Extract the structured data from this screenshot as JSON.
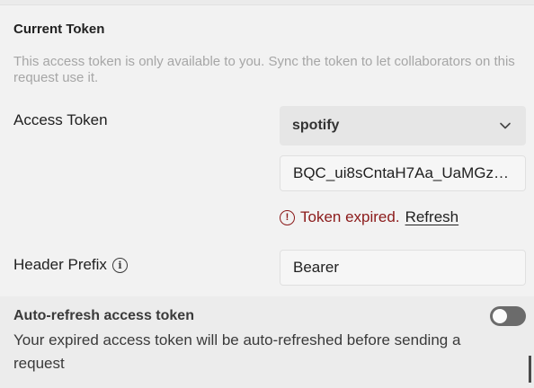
{
  "section": {
    "title": "Current Token",
    "description": "This access token is only available to you. Sync the token to let collaborators on this request use it."
  },
  "access_token": {
    "label": "Access Token",
    "selected_token": "spotify",
    "value": "BQC_ui8sCntaH7Aa_UaMGzF...",
    "status_text": "Token expired.",
    "refresh_label": "Refresh"
  },
  "header_prefix": {
    "label": "Header Prefix",
    "value": "Bearer"
  },
  "auto_refresh": {
    "title": "Auto-refresh access token",
    "description": "Your expired access token will be auto-refreshed before sending a request",
    "enabled": false
  },
  "colors": {
    "error": "#8b1a1a",
    "toggle_off": "#6b6b6b"
  },
  "icons": {
    "info": "info-icon",
    "warning": "warning-circle-icon",
    "chevron": "chevron-down-icon"
  }
}
